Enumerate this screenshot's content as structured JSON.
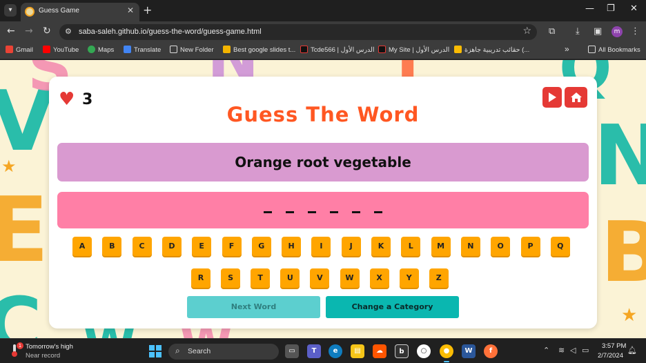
{
  "browser": {
    "tab_title": "Guess Game",
    "url": "saba-saleh.github.io/guess-the-word/guess-game.html",
    "profile_initial": "m",
    "bookmarks": [
      "Gmail",
      "YouTube",
      "Maps",
      "Translate",
      "New Folder",
      "Best google slides t...",
      "Tcde566 | الدرس الأول",
      "My Site | الدرس الأول",
      "حقائب تدريبية جاهزة (...",
      "All Bookmarks"
    ]
  },
  "game": {
    "lives": "3",
    "title": "Guess The Word",
    "hint": "Orange root vegetable",
    "blank_count": 6,
    "letters_row1": [
      "A",
      "B",
      "C",
      "D",
      "E",
      "F",
      "G",
      "H",
      "I",
      "J",
      "K",
      "L",
      "M",
      "N",
      "O",
      "P",
      "Q"
    ],
    "letters_row2": [
      "R",
      "S",
      "T",
      "U",
      "V",
      "W",
      "X",
      "Y",
      "Z"
    ],
    "next_word_label": "Next Word",
    "change_category_label": "Change a Category"
  },
  "taskbar": {
    "weather_line1": "Tomorrow's high",
    "weather_line2": "Near record",
    "weather_badge": "1",
    "search_label": "Search",
    "time": "3:57 PM",
    "date": "2/7/2024"
  },
  "colors": {
    "title": "#ff5722",
    "hint_bg": "#d99ad0",
    "word_bg": "#ff7fa6",
    "key_bg": "#ffa500",
    "accent_red": "#e53935",
    "teal": "#0ab7b0"
  }
}
